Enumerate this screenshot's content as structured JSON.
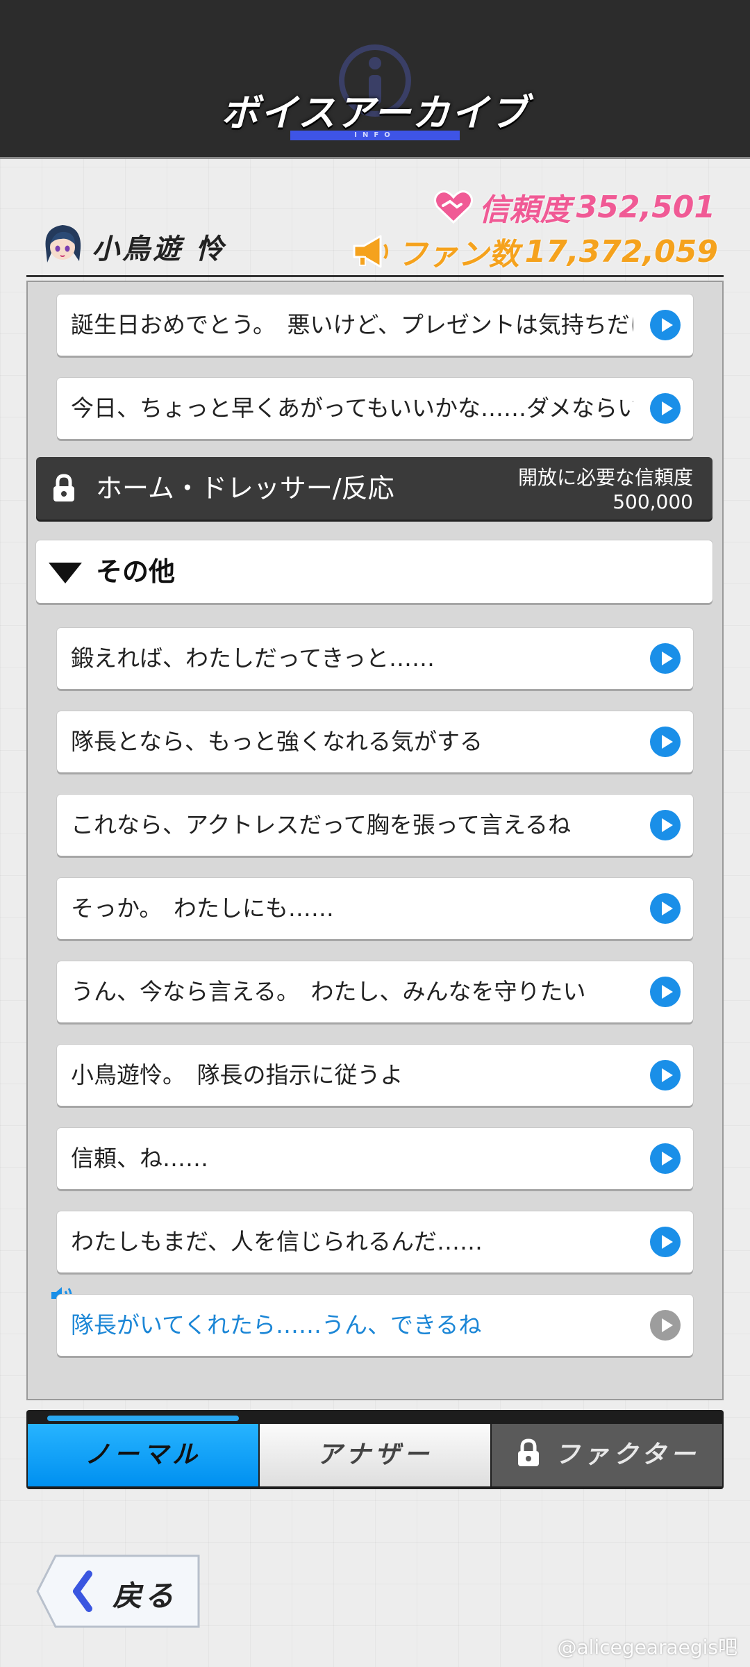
{
  "header": {
    "title": "ボイスアーカイブ",
    "subtitle": "INFO"
  },
  "character": {
    "name": "小鳥遊 怜",
    "trust_label": "信頼度",
    "trust_value": "352,501",
    "fan_label": "ファン数",
    "fan_value": "17,372,059"
  },
  "voices_top": [
    {
      "text": "誕生日おめでとう。　悪いけど、プレゼントは気持ちだけ"
    },
    {
      "text": "今日、ちょっと早くあがってもいいかな……ダメならいいけど"
    }
  ],
  "locked_section": {
    "label": "ホーム・ドレッサー/反応",
    "requirement_label": "開放に必要な信頼度",
    "requirement_value": "500,000"
  },
  "other_section": {
    "label": "その他",
    "items": [
      {
        "text": "鍛えれば、わたしだってきっと……"
      },
      {
        "text": "隊長となら、もっと強くなれる気がする"
      },
      {
        "text": "これなら、アクトレスだって胸を張って言えるね"
      },
      {
        "text": "そっか。　わたしにも……"
      },
      {
        "text": "うん、今なら言える。　わたし、みんなを守りたい"
      },
      {
        "text": "小鳥遊怜。　隊長の指示に従うよ"
      },
      {
        "text": "信頼、ね……"
      },
      {
        "text": "わたしもまだ、人を信じられるんだ……"
      },
      {
        "text": "隊長がいてくれたら……うん、できるね"
      }
    ]
  },
  "tabs": [
    {
      "label": "ノーマル"
    },
    {
      "label": "アナザー"
    },
    {
      "label": "ファクター"
    }
  ],
  "back_button": {
    "label": "戻る"
  },
  "watermark": "@alicegearaegis吧",
  "colors": {
    "trust": "#f05a95",
    "fans": "#f5a21d",
    "play": "#1a8fe8",
    "playing_text": "#1b86d6",
    "active_tab": "#0aa0f8"
  },
  "icons": [
    "info-icon",
    "heart-handshake-icon",
    "megaphone-icon",
    "play-icon",
    "lock-icon",
    "triangle-down-icon",
    "speaker-icon",
    "chevron-left-icon"
  ]
}
